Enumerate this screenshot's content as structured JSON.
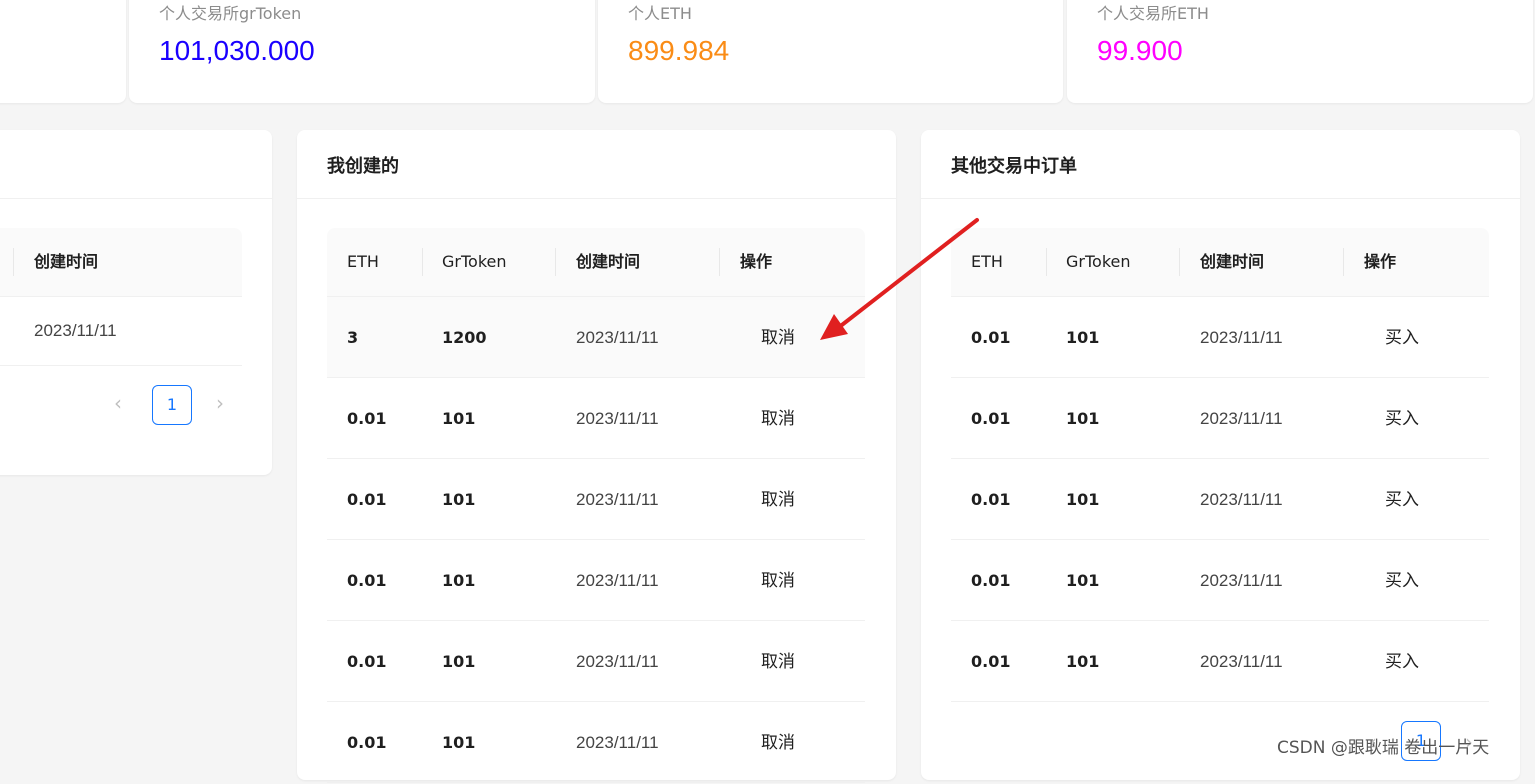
{
  "stats": [
    {
      "label": "个人交易所grToken",
      "value": "101,030.000",
      "color": "#1a00ff"
    },
    {
      "label": "个人ETH",
      "value": "899.984",
      "color": "#fa8c16"
    },
    {
      "label": "个人交易所ETH",
      "value": "99.900",
      "color": "#ff00ff"
    }
  ],
  "left_panel": {
    "header": "创建时间",
    "row_time": "2023/11/11",
    "page": "1"
  },
  "my_created": {
    "title": "我创建的",
    "columns": [
      "ETH",
      "GrToken",
      "创建时间",
      "操作"
    ],
    "rows": [
      {
        "eth": "3",
        "token": "1200",
        "time": "2023/11/11",
        "action": "取消"
      },
      {
        "eth": "0.01",
        "token": "101",
        "time": "2023/11/11",
        "action": "取消"
      },
      {
        "eth": "0.01",
        "token": "101",
        "time": "2023/11/11",
        "action": "取消"
      },
      {
        "eth": "0.01",
        "token": "101",
        "time": "2023/11/11",
        "action": "取消"
      },
      {
        "eth": "0.01",
        "token": "101",
        "time": "2023/11/11",
        "action": "取消"
      },
      {
        "eth": "0.01",
        "token": "101",
        "time": "2023/11/11",
        "action": "取消"
      }
    ]
  },
  "other_orders": {
    "title": "其他交易中订单",
    "columns": [
      "ETH",
      "GrToken",
      "创建时间",
      "操作"
    ],
    "rows": [
      {
        "eth": "0.01",
        "token": "101",
        "time": "2023/11/11",
        "action": "买入"
      },
      {
        "eth": "0.01",
        "token": "101",
        "time": "2023/11/11",
        "action": "买入"
      },
      {
        "eth": "0.01",
        "token": "101",
        "time": "2023/11/11",
        "action": "买入"
      },
      {
        "eth": "0.01",
        "token": "101",
        "time": "2023/11/11",
        "action": "买入"
      },
      {
        "eth": "0.01",
        "token": "101",
        "time": "2023/11/11",
        "action": "买入"
      }
    ],
    "page": "1"
  },
  "watermark": "CSDN @跟耿瑞 卷出一片天",
  "annotation_color": "#e02020"
}
